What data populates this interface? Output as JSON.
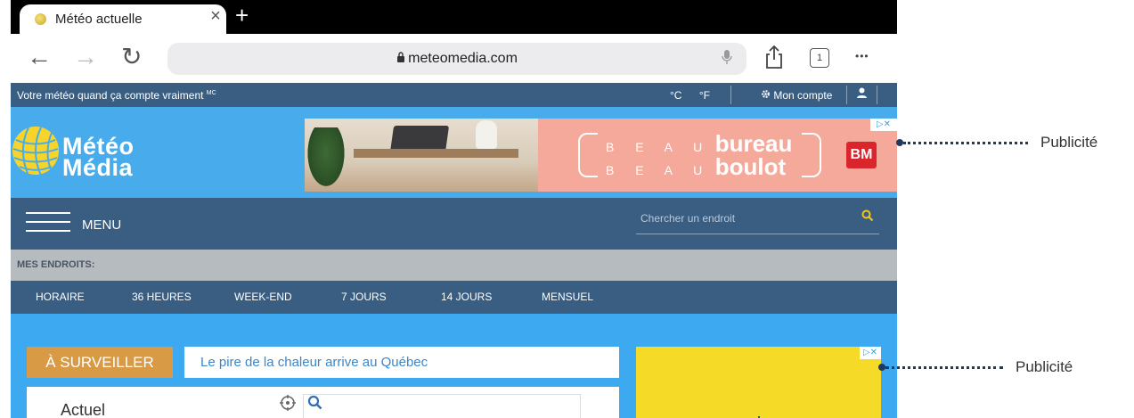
{
  "browser": {
    "tab_title": "Météo actuelle",
    "tab_close": "×",
    "new_tab": "+",
    "back_glyph": "←",
    "forward_glyph": "→",
    "reload_glyph": "↻",
    "url": "meteomedia.com",
    "lock_glyph": "🔒",
    "tabs_count": "1",
    "more_glyph": "•••",
    "icons": [
      "back-arrow-icon",
      "forward-arrow-icon",
      "reload-icon",
      "lock-icon",
      "microphone-icon",
      "share-icon",
      "tabs-icon",
      "more-icon"
    ]
  },
  "site": {
    "tagline": "Votre météo quand ça compte vraiment",
    "tagline_mark": "MC",
    "unit_c": "°C",
    "unit_f": "°F",
    "account_label": "Mon compte",
    "logo_line1": "Météo",
    "logo_line2": "Média",
    "menu_label": "MENU",
    "search_placeholder": "Chercher un endroit",
    "my_places": "MES ENDROITS:",
    "subnav": [
      "HORAIRE",
      "36 HEURES",
      "WEEK-END",
      "7 JOURS",
      "14 JOURS",
      "MENSUEL"
    ],
    "watch_tag": "À SURVEILLER",
    "watch_text": "Le pire de la chaleur arrive au Québec",
    "current_label": "Actuel"
  },
  "ad_banner": {
    "line1_prefix": "B E A U",
    "line1_word": "bureau",
    "line2_prefix": "B E A U",
    "line2_word": "boulot",
    "brand_badge": "BM"
  },
  "annotations": {
    "ad1_label": "Publicité",
    "ad2_label": "Publicité"
  },
  "colors": {
    "site_blue": "#3da9f0",
    "nav_dark": "#3a5d82",
    "watch_orange": "#d89a45",
    "ad_pink": "#f4a99a",
    "ad_yellow": "#f5db27"
  }
}
